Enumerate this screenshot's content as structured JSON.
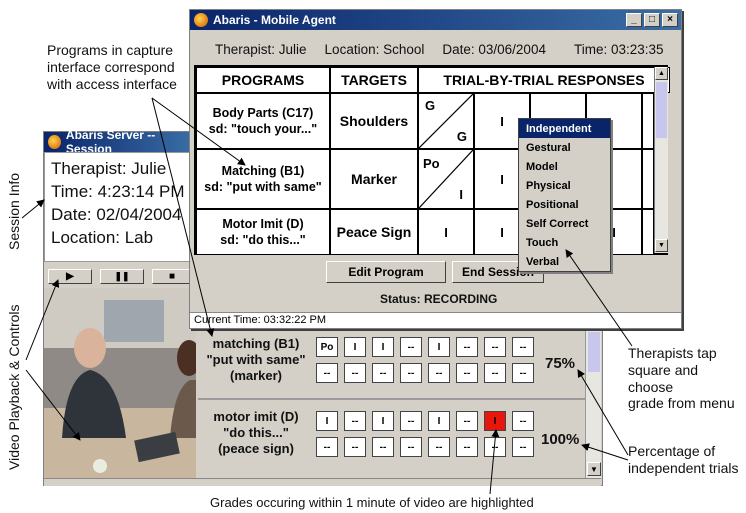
{
  "annotations": {
    "programs_line1": "Programs in capture",
    "programs_line2": "interface correspond",
    "programs_line3": "with access interface",
    "session_info": "Session Info",
    "video_playback": "Video Playback & Controls",
    "therapists_line1": "Therapists tap",
    "therapists_line2": "square and choose",
    "therapists_line3": "grade from menu",
    "percentage_line1": "Percentage of",
    "percentage_line2": "independent trials",
    "grades_highlight": "Grades occuring within 1 minute of video are highlighted"
  },
  "server_window": {
    "title": "Abaris Server -- Session",
    "therapist": "Therapist: Julie",
    "time": "Time: 4:23:14 PM",
    "date": "Date: 02/04/2004",
    "location": "Location: Lab",
    "controls": {
      "play": "▶",
      "pause": "❚❚",
      "stop": "■"
    },
    "rows": [
      {
        "line1": "matching (B1)",
        "line2": "\"put with same\"",
        "line3": "(marker)",
        "top": [
          "Po",
          "I",
          "I",
          "--",
          "I",
          "--",
          "--",
          "--"
        ],
        "bottom": [
          "--",
          "--",
          "--",
          "--",
          "--",
          "--",
          "--",
          "--"
        ],
        "percent": "75%"
      },
      {
        "line1": "motor imit (D)",
        "line2": "\"do this...\"",
        "line3": "(peace sign)",
        "top": [
          "I",
          "--",
          "I",
          "--",
          "I",
          "--",
          "I",
          "--"
        ],
        "bottom": [
          "--",
          "--",
          "--",
          "--",
          "--",
          "--",
          "--",
          "--"
        ],
        "percent": "100%"
      }
    ]
  },
  "mobile_window": {
    "title": "Abaris - Mobile Agent",
    "therapist": "Therapist: Julie",
    "location": "Location: School",
    "date": "Date: 03/06/2004",
    "time": "Time: 03:23:35",
    "headers": {
      "programs": "PROGRAMS",
      "targets": "TARGETS",
      "responses": "TRIAL-BY-TRIAL RESPONSES"
    },
    "rows": [
      {
        "program_line1": "Body Parts (C17)",
        "program_line2": "sd: \"touch your...\"",
        "target": "Shoulders",
        "first_top": "G",
        "first_bottom": "G",
        "second": "I"
      },
      {
        "program_line1": "Matching (B1)",
        "program_line2": "sd: \"put with same\"",
        "target": "Marker",
        "first_top": "Po",
        "first_bottom": "I",
        "second": "I"
      },
      {
        "program_line1": "Motor Imit (D)",
        "program_line2": "sd: \"do this...\"",
        "target": "Peace Sign",
        "first_top": "I",
        "first_bottom": "",
        "second": "I",
        "extra": "I"
      }
    ],
    "edit_button": "Edit Program",
    "end_button": "End Session",
    "status": "Status:  RECORDING",
    "current_time": "Current Time:  03:32:22 PM"
  },
  "grade_menu": [
    "Independent",
    "Gestural",
    "Model",
    "Physical",
    "Positional",
    "Self Correct",
    "Touch",
    "Verbal"
  ],
  "colors": {
    "highlight": "#e8160c",
    "selected_menu": "#0a246a",
    "window_gray": "#d4d0c8"
  }
}
